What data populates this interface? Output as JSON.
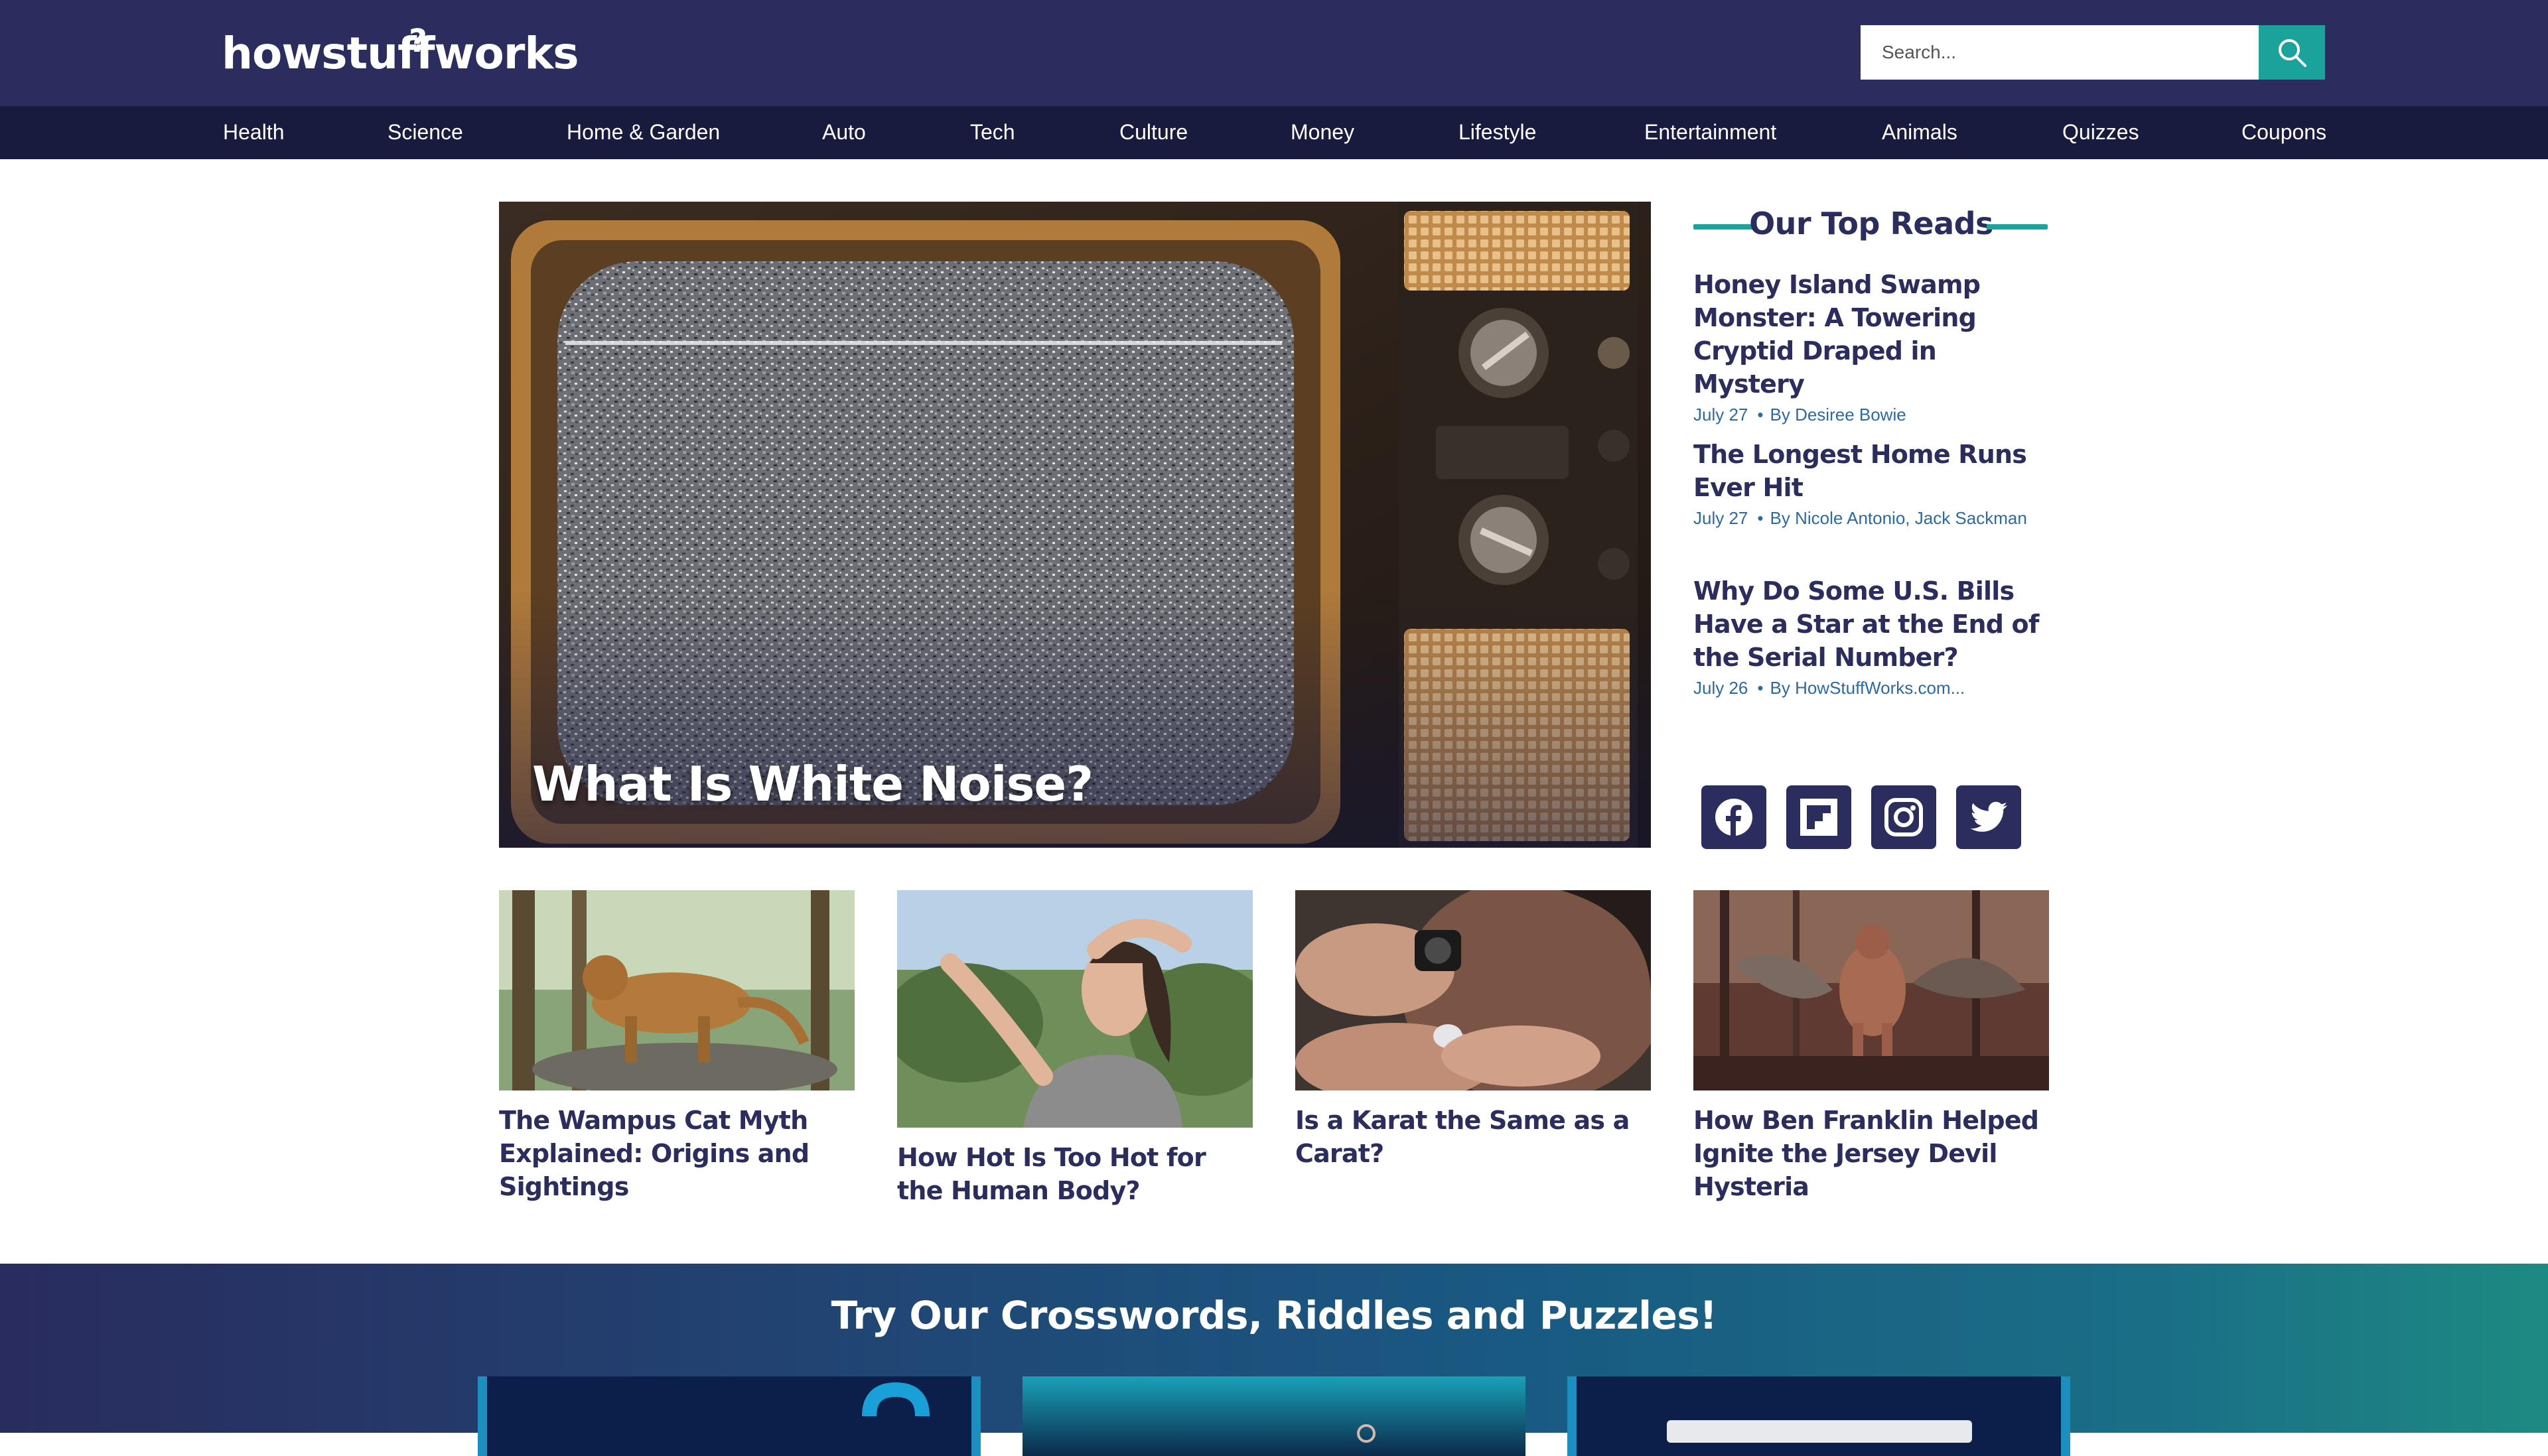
{
  "brand": {
    "logo_text": "howstuffworks",
    "logo_mark": "?"
  },
  "search": {
    "placeholder": "Search..."
  },
  "nav": [
    {
      "label": "Health"
    },
    {
      "label": "Science"
    },
    {
      "label": "Home & Garden"
    },
    {
      "label": "Auto"
    },
    {
      "label": "Tech"
    },
    {
      "label": "Culture"
    },
    {
      "label": "Money"
    },
    {
      "label": "Lifestyle"
    },
    {
      "label": "Entertainment"
    },
    {
      "label": "Animals"
    },
    {
      "label": "Quizzes"
    },
    {
      "label": "Coupons"
    }
  ],
  "hero": {
    "title": "What Is White Noise?",
    "image": "static-tv-image"
  },
  "top_reads": {
    "heading": "Our Top Reads",
    "items": [
      {
        "title": "Honey Island Swamp Monster: A Towering Cryptid Draped in Mystery",
        "date": "July 27",
        "byline": "By Desiree Bowie"
      },
      {
        "title": "The Longest Home Runs Ever Hit",
        "date": "July 27",
        "byline": "By Nicole Antonio, Jack Sackman"
      },
      {
        "title": "Why Do Some U.S. Bills Have a Star at the End of the Serial Number?",
        "date": "July 26",
        "byline": "By HowStuffWorks.com..."
      }
    ]
  },
  "social": [
    {
      "name": "facebook-icon"
    },
    {
      "name": "flipboard-icon"
    },
    {
      "name": "instagram-icon"
    },
    {
      "name": "twitter-icon"
    }
  ],
  "cards": [
    {
      "title": "The Wampus Cat Myth Explained: Origins and Sightings",
      "image": "wampus-cat-image"
    },
    {
      "title": "How Hot Is Too Hot for the Human Body?",
      "image": "hot-woman-image"
    },
    {
      "title": "Is a Karat the Same as a Carat?",
      "image": "jeweler-loupe-image"
    },
    {
      "title": "How Ben Franklin Helped Ignite the Jersey Devil Hysteria",
      "image": "jersey-devil-image"
    }
  ],
  "puzzles": {
    "heading": "Try Our Crosswords, Riddles and Puzzles!"
  },
  "colors": {
    "header_bg": "#2b2d5e",
    "nav_bg": "#181a3e",
    "accent": "#1aa39a",
    "link": "#2b6aa8"
  }
}
